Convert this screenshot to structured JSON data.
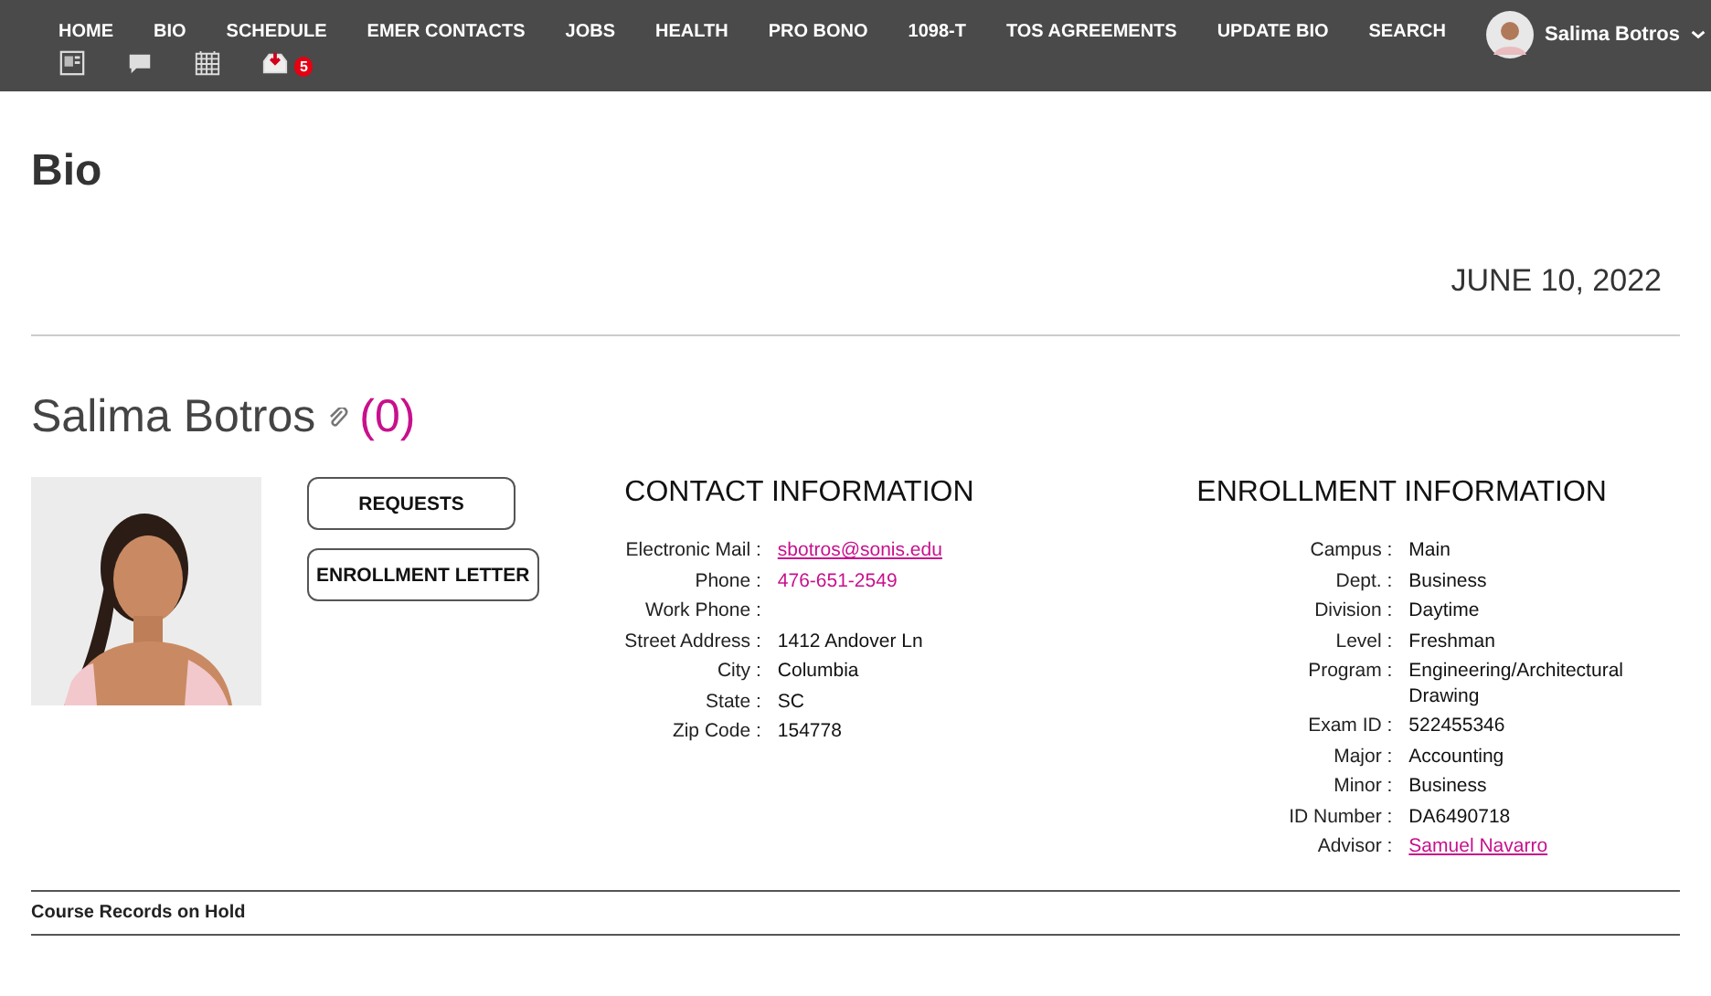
{
  "nav": {
    "items": [
      "HOME",
      "BIO",
      "SCHEDULE",
      "EMER CONTACTS",
      "JOBS",
      "HEALTH",
      "PRO BONO",
      "1098-T",
      "TOS AGREEMENTS",
      "UPDATE BIO",
      "SEARCH"
    ],
    "user": "Salima Botros",
    "icons": [
      {
        "kind": "id-card"
      },
      {
        "kind": "chat"
      },
      {
        "kind": "calendar"
      },
      {
        "kind": "inbox",
        "badge": "5"
      }
    ]
  },
  "page": {
    "title": "Bio",
    "date": "JUNE 10, 2022"
  },
  "profile": {
    "name": "Salima Botros",
    "count": "(0)",
    "buttons": [
      "REQUESTS",
      "ENROLLMENT LETTER"
    ]
  },
  "contact": {
    "title": "CONTACT INFORMATION",
    "fields": [
      {
        "label": "Electronic Mail :",
        "value": "sbotros@sonis.edu",
        "kind": "link"
      },
      {
        "label": "Phone :",
        "value": "476-651-2549",
        "kind": "accent"
      },
      {
        "label": "Work Phone :"
      },
      {
        "label": "Street Address :",
        "value": "1412 Andover Ln",
        "kind": "text"
      },
      {
        "label": "City :",
        "value": "Columbia",
        "kind": "text"
      },
      {
        "label": "State :",
        "value": "SC",
        "kind": "text"
      },
      {
        "label": "Zip Code :",
        "value": "154778",
        "kind": "text"
      }
    ]
  },
  "enrollment": {
    "title": "ENROLLMENT INFORMATION",
    "fields": [
      {
        "label": "Campus :",
        "value": "Main",
        "kind": "text"
      },
      {
        "label": "Dept. :",
        "value": "Business",
        "kind": "text"
      },
      {
        "label": "Division :",
        "value": "Daytime",
        "kind": "text"
      },
      {
        "label": "Level :",
        "value": "Freshman",
        "kind": "text"
      },
      {
        "label": "Program :",
        "value": "Engineering/Architectural Drawing",
        "kind": "text"
      },
      {
        "label": "Exam ID :",
        "value": "522455346",
        "kind": "text"
      },
      {
        "label": "Major :",
        "value": "Accounting",
        "kind": "text"
      },
      {
        "label": "Minor :",
        "value": "Business",
        "kind": "text"
      },
      {
        "label": "ID Number :",
        "value": "DA6490718",
        "kind": "text"
      },
      {
        "label": "Advisor :",
        "value": "Samuel Navarro",
        "kind": "link"
      }
    ]
  },
  "holds": {
    "title": "Course Records on Hold"
  }
}
